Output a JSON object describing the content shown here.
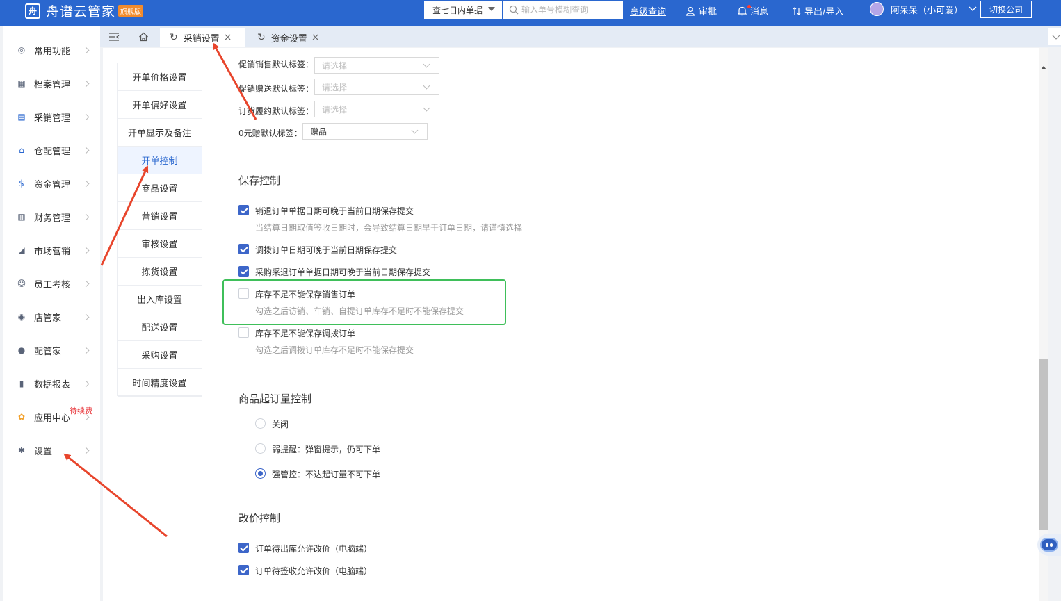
{
  "app": {
    "logo_mark": "舟",
    "name": "舟谱云管家",
    "edition_badge": "旗舰版"
  },
  "topbar": {
    "search_scope": "查七日内单据",
    "search_placeholder": "输入单号模糊查询",
    "advanced_query": "高级查询",
    "approve": "审批",
    "messages": "消息",
    "import_export": "导出/导入",
    "user": "阿呆呆（小可爱）",
    "switch_company": "切换公司"
  },
  "sidebar": {
    "items": [
      {
        "label": "常用功能",
        "icon": "target-icon"
      },
      {
        "label": "档案管理",
        "icon": "grid-icon"
      },
      {
        "label": "采销管理",
        "icon": "clipboard-icon"
      },
      {
        "label": "仓配管理",
        "icon": "warehouse-icon"
      },
      {
        "label": "资金管理",
        "icon": "money-bag-icon"
      },
      {
        "label": "财务管理",
        "icon": "calculator-icon"
      },
      {
        "label": "市场营销",
        "icon": "megaphone-icon"
      },
      {
        "label": "员工考核",
        "icon": "people-icon"
      },
      {
        "label": "店管家",
        "icon": "store-icon"
      },
      {
        "label": "配管家",
        "icon": "delivery-icon"
      },
      {
        "label": "数据报表",
        "icon": "bar-chart-icon"
      },
      {
        "label": "应用中心",
        "icon": "apps-icon",
        "badge": "待续费"
      },
      {
        "label": "设置",
        "icon": "gear-icon"
      }
    ]
  },
  "tabs": [
    {
      "label": "采销设置",
      "active": true
    },
    {
      "label": "资金设置",
      "active": false
    }
  ],
  "subnav": {
    "items": [
      "开单价格设置",
      "开单偏好设置",
      "开单显示及备注",
      "开单控制",
      "商品设置",
      "营销设置",
      "审核设置",
      "拣货设置",
      "出入库设置",
      "配送设置",
      "采购设置",
      "时间精度设置"
    ],
    "active_index": 3
  },
  "tag_settings": {
    "promo_sale_label": "促销销售默认标签：",
    "promo_gift_label": "促销赠送默认标签：",
    "order_fulfill_label": "订货履约默认标签：",
    "zero_gift_label": "0元赠默认标签：",
    "placeholder": "请选择",
    "zero_gift_value": "赠品"
  },
  "save_control": {
    "title": "保存控制",
    "options": [
      {
        "label": "销退订单单据日期可晚于当前日期保存提交",
        "checked": true,
        "hint": "当结算日期取值签收日期时，会导致结算日期早于订单日期，请谨慎选择"
      },
      {
        "label": "调拨订单日期可晚于当前日期保存提交",
        "checked": true,
        "hint": ""
      },
      {
        "label": "采购采退订单单据日期可晚于当前日期保存提交",
        "checked": true,
        "hint": ""
      },
      {
        "label": "库存不足不能保存销售订单",
        "checked": false,
        "hint": "勾选之后访销、车销、自提订单库存不足时不能保存提交"
      },
      {
        "label": "库存不足不能保存调拨订单",
        "checked": false,
        "hint": "勾选之后调拨订单库存不足时不能保存提交"
      }
    ]
  },
  "min_order_control": {
    "title": "商品起订量控制",
    "options": [
      {
        "label": "关闭",
        "selected": false
      },
      {
        "label": "弱提醒：弹窗提示，仍可下单",
        "selected": false
      },
      {
        "label": "强管控：不达起订量不可下单",
        "selected": true
      }
    ]
  },
  "price_change_control": {
    "title": "改价控制",
    "options": [
      {
        "label": "订单待出库允许改价（电脑端）",
        "checked": true
      },
      {
        "label": "订单待签收允许改价（电脑端）",
        "checked": true
      }
    ]
  },
  "colors": {
    "brand": "#2a67cf",
    "checkbox": "#3d66c9",
    "highlight": "#3fbf5a",
    "arrow": "#e8452c",
    "badge": "#e8363b"
  }
}
